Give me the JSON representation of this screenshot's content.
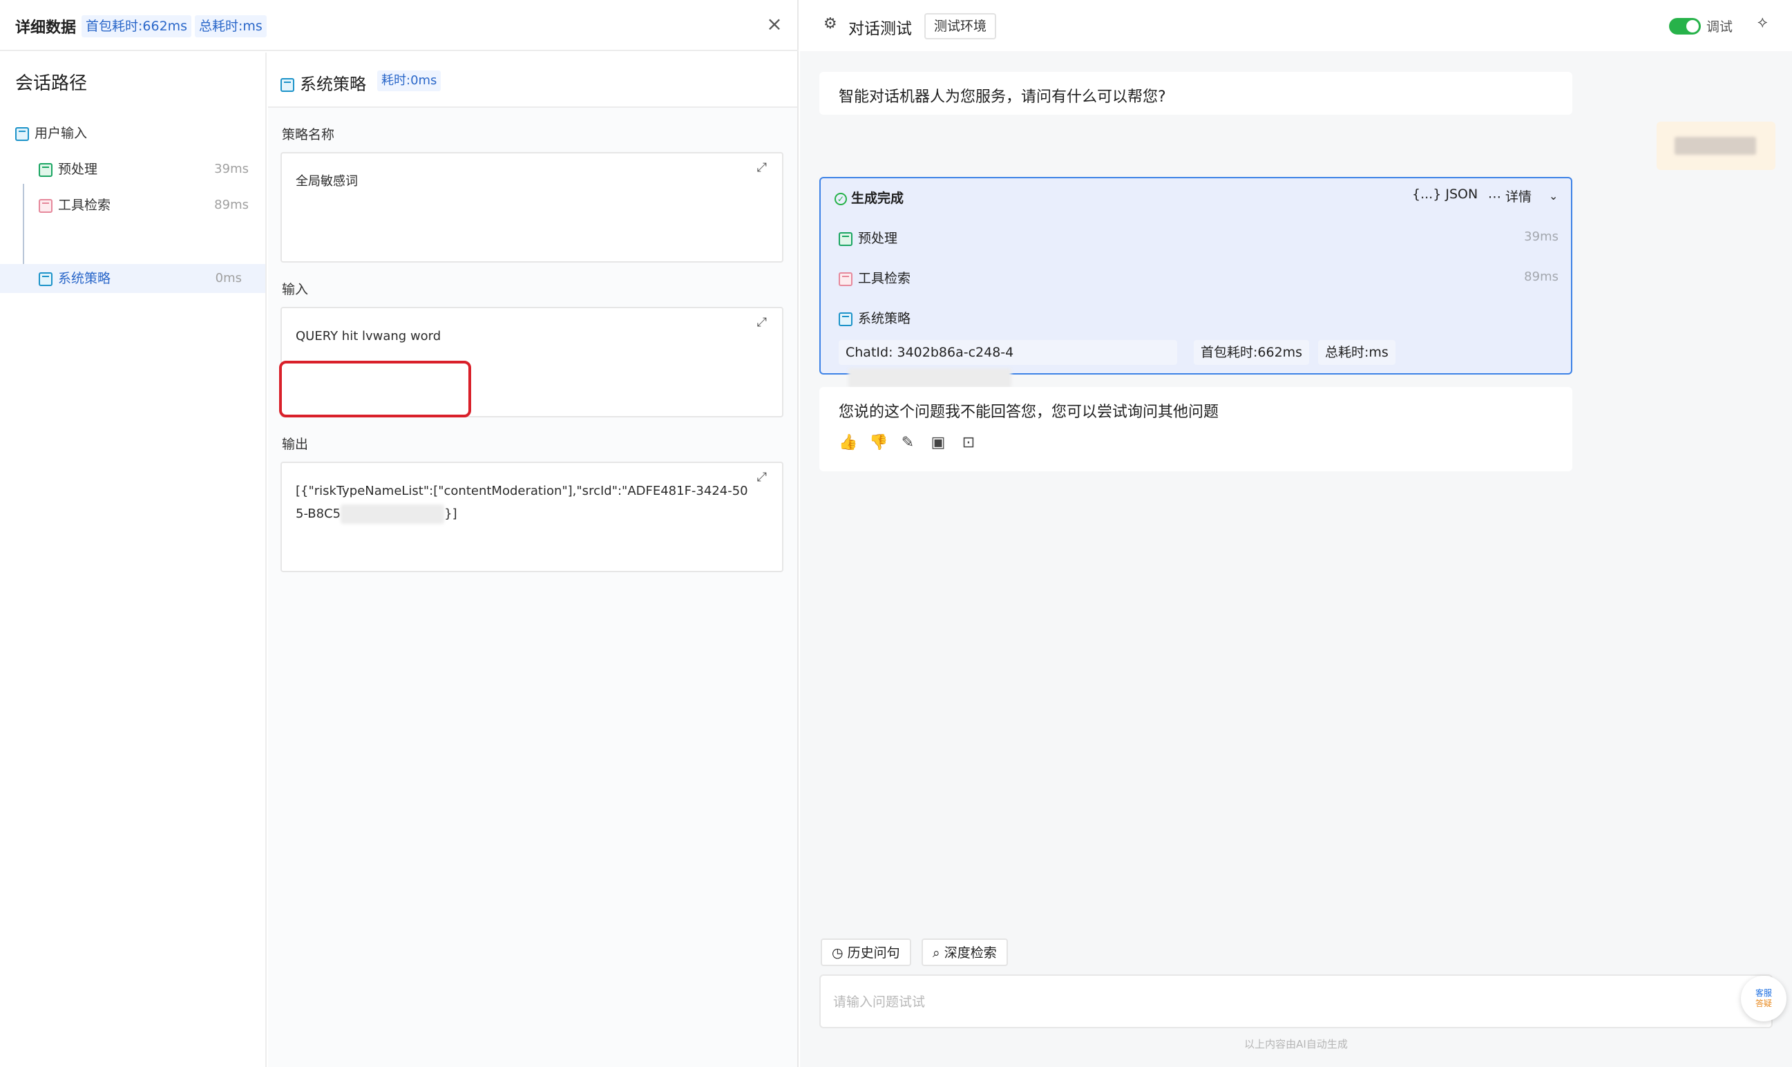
{
  "detail": {
    "title": "详细数据",
    "first_packet": "首包耗时:662ms",
    "total": "总耗时:ms",
    "close_glyph": "×"
  },
  "path": {
    "title": "会话路径",
    "items": [
      {
        "label": "用户输入",
        "ms": "",
        "icon": "message-icon"
      },
      {
        "label": "预处理",
        "ms": "39ms",
        "icon": "edit-doc-icon"
      },
      {
        "label": "工具检索",
        "ms": "89ms",
        "icon": "tool-icon"
      },
      {
        "label": "系统策略",
        "ms": "0ms",
        "icon": "policy-icon"
      }
    ],
    "active_index": 3
  },
  "node": {
    "title": "系统策略",
    "time": "耗时:0ms",
    "policy_label": "策略名称",
    "policy_value": "全局敏感词",
    "input_label": "输入",
    "input_value": "QUERY hit lvwang word",
    "output_label": "输出",
    "output_value_a": "[{\"riskTypeNameList\":[\"contentModeration\"],\"srcId\":\"ADFE481F-3424-50",
    "output_value_b_prefix": "5-B8C5",
    "output_value_b_suffix": "}]",
    "expand_glyph": "⤢"
  },
  "chat": {
    "title": "对话测试",
    "env": "测试环境",
    "debug_label": "调试",
    "debug_on": true,
    "greeting": "智能对话机器人为您服务，请问有什么可以帮您?",
    "trace": {
      "status": "生成完成",
      "json_label": "{...} JSON",
      "detail_label": "⋯ 详情",
      "rows": [
        {
          "label": "预处理",
          "ms": "39ms"
        },
        {
          "label": "工具检索",
          "ms": "89ms"
        },
        {
          "label": "系统策略",
          "ms": ""
        }
      ],
      "chat_id": "ChatId: 3402b86a-c248-4",
      "first_packet": "首包耗时:662ms",
      "total": "总耗时:ms"
    },
    "answer": "您说的这个问题我不能回答您，您可以尝试询问其他问题",
    "history_label": "历史问句",
    "deep_search_label": "深度检索",
    "input_placeholder": "请输入问题试试",
    "service_a": "客服",
    "service_b": "答疑",
    "footer": "以上内容由AI自动生成"
  },
  "colors": {
    "accent": "#2a67c9",
    "trace_border": "#3d82e6",
    "toggle_on": "#27b24a",
    "highlight": "#d9202a"
  }
}
